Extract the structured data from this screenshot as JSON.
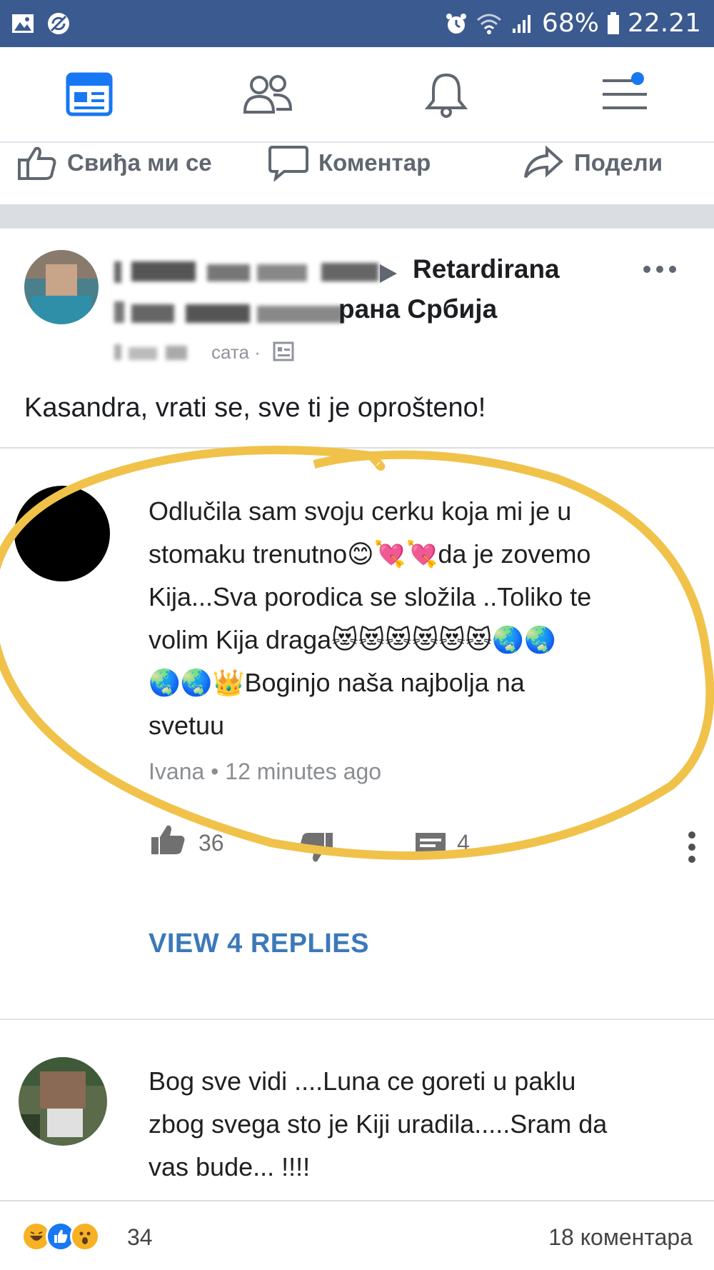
{
  "status_bar": {
    "battery": "68%",
    "time": "22.21"
  },
  "nav": {
    "icons": [
      "news-feed-icon",
      "friends-icon",
      "notifications-icon",
      "menu-icon"
    ]
  },
  "post_actions": {
    "like": "Свиђа ми се",
    "comment": "Коментар",
    "share": "Подели"
  },
  "post": {
    "group_line1": "Retardirana",
    "group_line2": "рана Србија",
    "time_suffix": "сата ·",
    "text": "Kasandra, vrati se, sve ti je oprošteno!"
  },
  "comment1": {
    "lines": [
      "Odlučila sam svoju cerku koja mi je u",
      "stomaku trenutno😊💘💘da je zovemo",
      "Kija...Sva porodica se složila ..Toliko te",
      "volim Kija draga😻😻😻😻😻😻🌏🌏",
      "🌏🌏👑Boginjo naša najbolja na",
      "svetuu"
    ],
    "author": "Ivana",
    "time": "12 minutes ago",
    "likes": "36",
    "replies_count": "4",
    "view_replies": "VIEW 4 REPLIES"
  },
  "comment2": {
    "lines": [
      "Bog sve vidi ....Luna ce goreti u paklu",
      "zbog svega sto je Kiji uradila.....Sram da",
      "vas bude...  !!!!"
    ]
  },
  "footer": {
    "reaction_count": "34",
    "comment_count": "18 коментара"
  },
  "colors": {
    "status_bar": "#3b5a8f",
    "fb_blue": "#1877f2",
    "highlight_circle": "#f0c24a",
    "link_blue": "#3b79b9"
  }
}
